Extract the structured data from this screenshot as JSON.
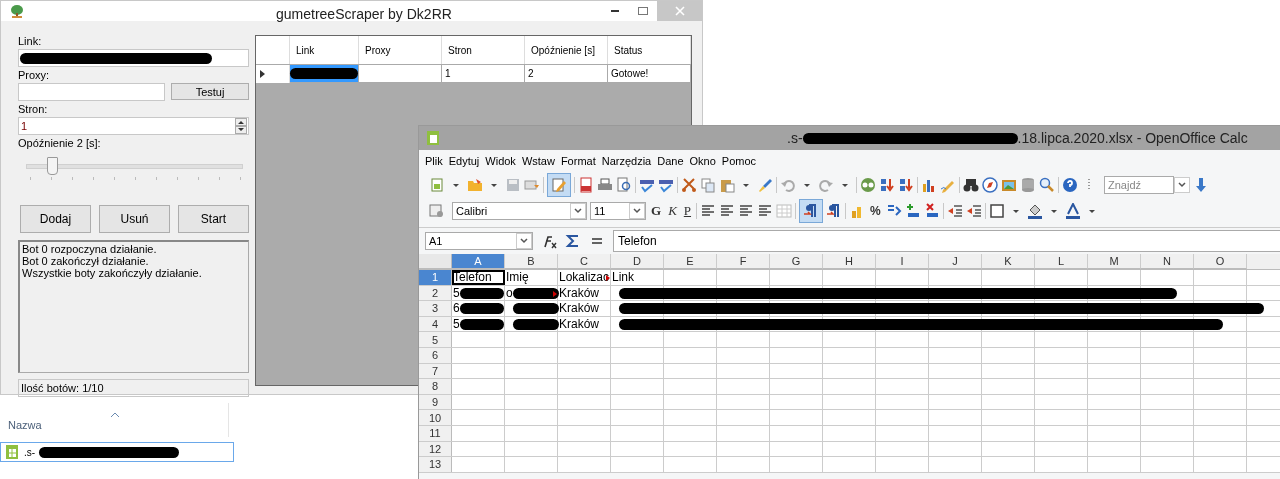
{
  "scraper": {
    "title": "gumetreeScraper by Dk2RR",
    "form": {
      "link_label": "Link:",
      "link_value": {
        "redacted": true
      },
      "proxy_label": "Proxy:",
      "test_button": "Testuj",
      "pages_label": "Stron:",
      "pages_value": "1",
      "delay_label": "Opóźnienie 2 [s]:",
      "delay_slider": {
        "level": 0.1
      }
    },
    "buttons": [
      "Dodaj",
      "Usuń",
      "Start"
    ],
    "log": [
      "Bot 0 rozpoczyna działanie.",
      "Bot 0 zakończył działanie.",
      "Wszystkie boty zakończyły działanie."
    ],
    "status": "Ilość botów: 1/10",
    "grid": {
      "columns": [
        "Link",
        "Proxy",
        "Stron",
        "Opóźnienie [s]",
        "Status"
      ],
      "rows": [
        {
          "selected": true,
          "cells": [
            {
              "redacted": true
            },
            {},
            {
              "text": "1"
            },
            {
              "text": "2"
            },
            {
              "text": "Gotowe!"
            }
          ]
        }
      ]
    }
  },
  "explorer": {
    "column": "Nazwa",
    "files": [
      {
        "name": ".s-",
        "redacted": true,
        "selected": true
      }
    ]
  },
  "calc": {
    "title": [
      {
        "text": ".s-"
      },
      {
        "redacted": true
      },
      {
        "text": ".18.lipca.2020.xlsx - OpenOffice Calc"
      }
    ],
    "menu": [
      "Plik",
      "Edytuj",
      "Widok",
      "Wstaw",
      "Format",
      "Narzędzia",
      "Dane",
      "Okno",
      "Pomoc"
    ],
    "edit_mode": {
      "on": true
    },
    "find_placeholder": "Znajdź",
    "font": "Calibri",
    "size": "11",
    "bold_label": "G",
    "italic_label": "K",
    "underline_label": "P",
    "text_direction": {
      "on": true
    },
    "percent_label": "%",
    "name_box": "A1",
    "formula": "Telefon",
    "sheet": {
      "columns": [
        {
          "label": "A",
          "selected": true
        },
        {
          "label": "B",
          "selected": false
        },
        {
          "label": "C",
          "selected": false
        },
        {
          "label": "D",
          "selected": false
        },
        {
          "label": "E",
          "selected": false
        },
        {
          "label": "F",
          "selected": false
        },
        {
          "label": "G",
          "selected": false
        },
        {
          "label": "H",
          "selected": false
        },
        {
          "label": "I",
          "selected": false
        },
        {
          "label": "J",
          "selected": false
        },
        {
          "label": "K",
          "selected": false
        },
        {
          "label": "L",
          "selected": false
        },
        {
          "label": "M",
          "selected": false
        },
        {
          "label": "N",
          "selected": false
        },
        {
          "label": "O",
          "selected": false
        }
      ],
      "rows": [
        {
          "label": "1",
          "selected": true,
          "cells": [
            {
              "text": "Telefon",
              "selected": true
            },
            {
              "text": "Imię"
            },
            {
              "text": "Lokalizac",
              "overflow": true
            },
            {
              "text": "Link"
            }
          ]
        },
        {
          "label": "2",
          "selected": false,
          "cells": [
            {
              "text": "5",
              "redacted": true
            },
            {
              "text": "o",
              "redacted": true,
              "overflow": true
            },
            {
              "text": "Kraków"
            },
            {
              "redacted": true
            }
          ]
        },
        {
          "label": "3",
          "selected": false,
          "cells": [
            {
              "text": "6",
              "redacted": true
            },
            {
              "redacted": true
            },
            {
              "text": "Kraków"
            },
            {
              "redacted": true
            }
          ]
        },
        {
          "label": "4",
          "selected": false,
          "cells": [
            {
              "text": "5",
              "redacted": true
            },
            {
              "redacted": true
            },
            {
              "text": "Kraków"
            },
            {
              "redacted": true
            }
          ]
        },
        {
          "label": "5",
          "selected": false,
          "cells": []
        },
        {
          "label": "6",
          "selected": false,
          "cells": []
        },
        {
          "label": "7",
          "selected": false,
          "cells": []
        },
        {
          "label": "8",
          "selected": false,
          "cells": []
        },
        {
          "label": "9",
          "selected": false,
          "cells": []
        },
        {
          "label": "10",
          "selected": false,
          "cells": []
        },
        {
          "label": "11",
          "selected": false,
          "cells": []
        },
        {
          "label": "12",
          "selected": false,
          "cells": []
        },
        {
          "label": "13",
          "selected": false,
          "cells": []
        }
      ]
    }
  }
}
